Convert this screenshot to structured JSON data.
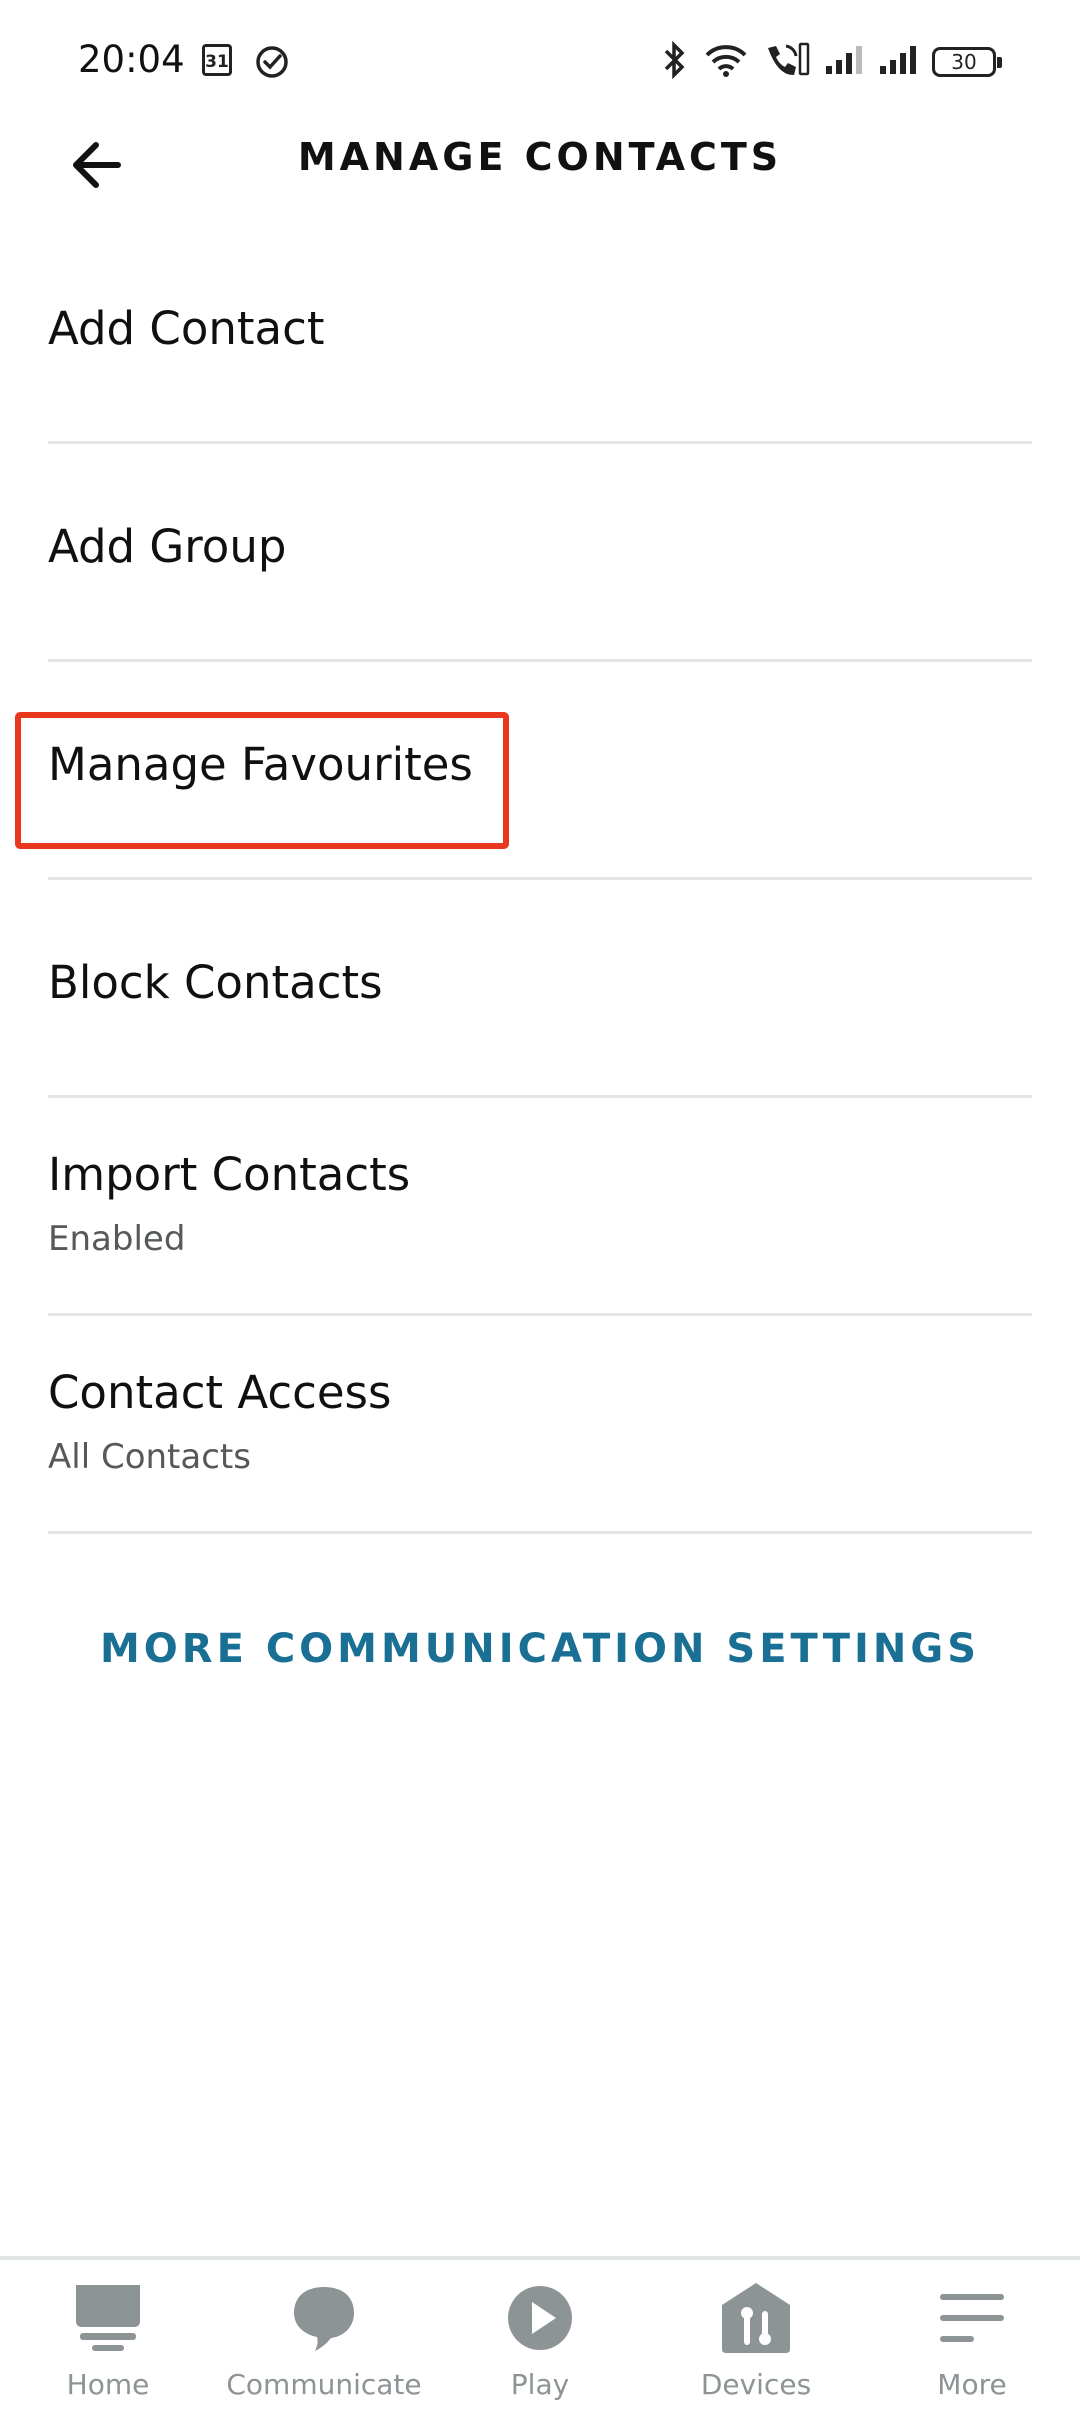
{
  "status_bar": {
    "time": "20:04",
    "calendar_day": "31",
    "battery": "30"
  },
  "header": {
    "title": "MANAGE CONTACTS"
  },
  "menu": {
    "items": [
      {
        "label": "Add Contact"
      },
      {
        "label": "Add Group"
      },
      {
        "label": "Manage Favourites",
        "highlighted": true
      },
      {
        "label": "Block Contacts"
      },
      {
        "label": "Import Contacts",
        "subtitle": "Enabled"
      },
      {
        "label": "Contact Access",
        "subtitle": "All Contacts"
      }
    ]
  },
  "more_settings_label": "MORE COMMUNICATION SETTINGS",
  "bottom_nav": {
    "items": [
      {
        "label": "Home",
        "icon": "home-icon"
      },
      {
        "label": "Communicate",
        "icon": "chat-bubble-icon"
      },
      {
        "label": "Play",
        "icon": "play-icon"
      },
      {
        "label": "Devices",
        "icon": "devices-icon"
      },
      {
        "label": "More",
        "icon": "menu-icon"
      }
    ]
  },
  "colors": {
    "accent_link": "#1a6f94",
    "highlight_box": "#e8371c",
    "nav_inactive": "#8d9496",
    "divider": "#e3e6e6"
  }
}
